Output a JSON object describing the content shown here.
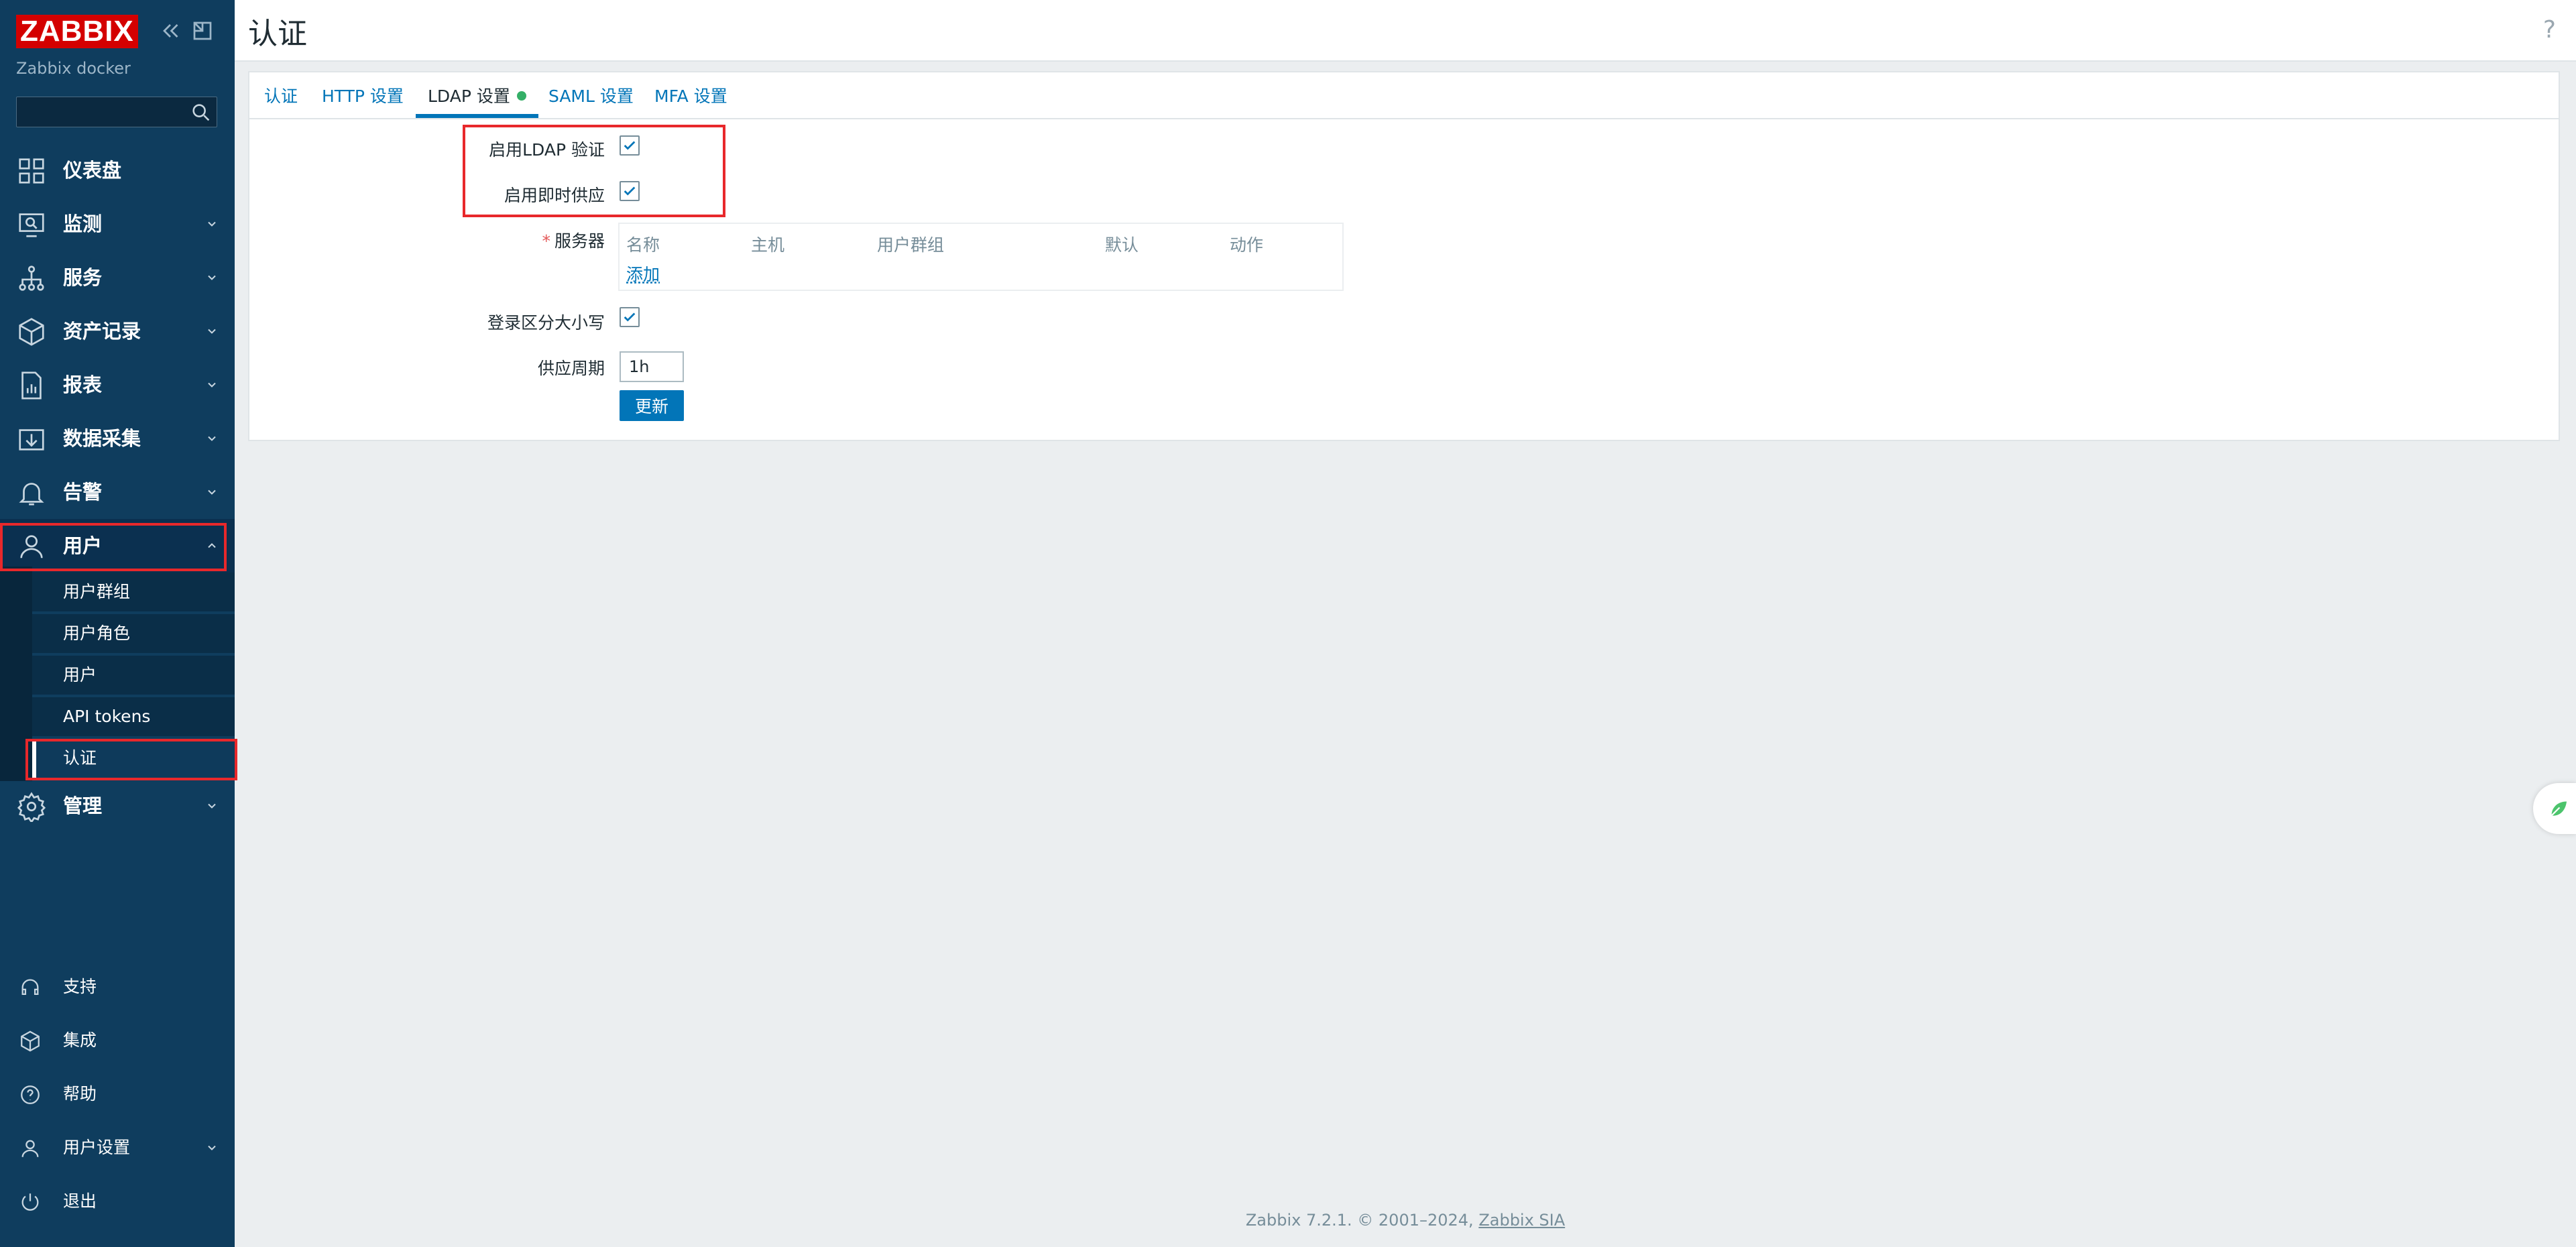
{
  "sidebar": {
    "logo": "ZABBIX",
    "server_name": "Zabbix docker",
    "search": {
      "value": "",
      "placeholder": ""
    },
    "menu": [
      {
        "label": "仪表盘",
        "icon": "dashboard-icon"
      },
      {
        "label": "监测",
        "icon": "monitoring-icon"
      },
      {
        "label": "服务",
        "icon": "services-icon"
      },
      {
        "label": "资产记录",
        "icon": "inventory-icon"
      },
      {
        "label": "报表",
        "icon": "reports-icon"
      },
      {
        "label": "数据采集",
        "icon": "data-collection-icon"
      },
      {
        "label": "告警",
        "icon": "alerts-icon"
      },
      {
        "label": "用户",
        "icon": "users-icon"
      },
      {
        "label": "管理",
        "icon": "administration-icon"
      }
    ],
    "users_submenu": [
      "用户群组",
      "用户角色",
      "用户",
      "API tokens",
      "认证"
    ],
    "bottom": [
      {
        "label": "支持",
        "icon": "support-icon"
      },
      {
        "label": "集成",
        "icon": "integrations-icon"
      },
      {
        "label": "帮助",
        "icon": "help-icon"
      },
      {
        "label": "用户设置",
        "icon": "user-settings-icon"
      },
      {
        "label": "退出",
        "icon": "logout-icon"
      }
    ]
  },
  "header": {
    "title": "认证",
    "help": "?"
  },
  "tabs": [
    "认证",
    "HTTP 设置",
    "LDAP 设置",
    "SAML 设置",
    "MFA 设置"
  ],
  "active_tab": "LDAP 设置",
  "form": {
    "enable_ldap_label": "启用LDAP 验证",
    "enable_ldap_checked": true,
    "enable_jit_label": "启用即时供应",
    "enable_jit_checked": true,
    "servers_required_mark": "*",
    "servers_label": "服务器",
    "servers_table": {
      "headers": [
        "名称",
        "主机",
        "用户群组",
        "默认",
        "动作"
      ],
      "add_link": "添加"
    },
    "case_sensitive_label": "登录区分大小写",
    "case_sensitive_checked": true,
    "period_label": "供应周期",
    "period_value": "1h",
    "update_button": "更新"
  },
  "footer": {
    "text": "Zabbix 7.2.1. © 2001–2024, ",
    "link": "Zabbix SIA"
  },
  "colors": {
    "sidebar": "#0f3d5e",
    "accent": "#0275b8",
    "logo": "#d40000",
    "highlight": "#e8282b"
  }
}
